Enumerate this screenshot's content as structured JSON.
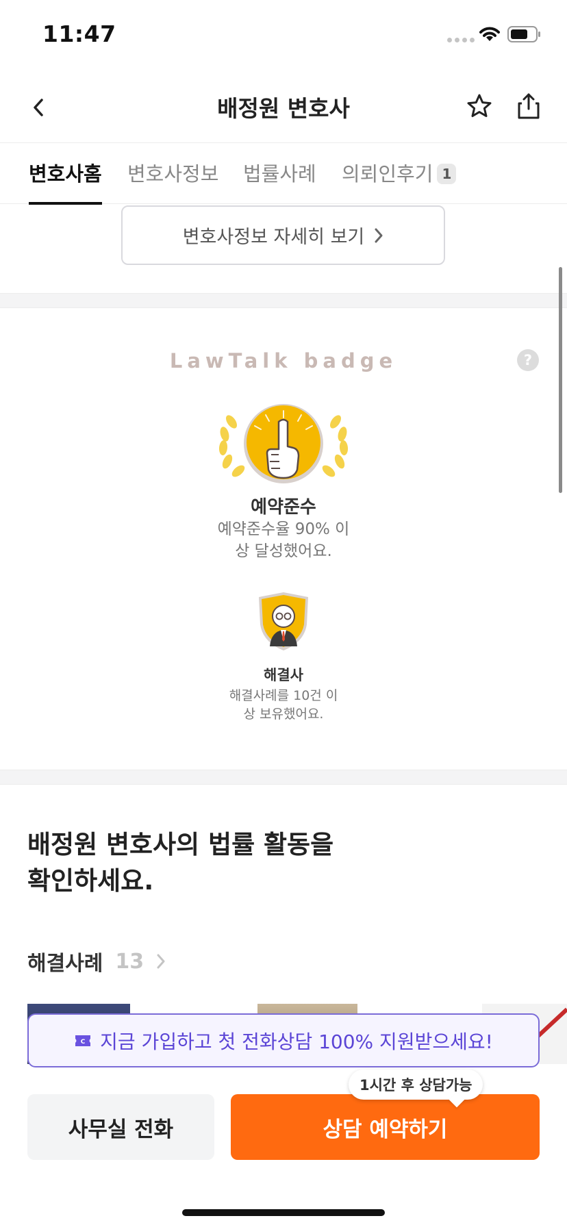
{
  "status_bar": {
    "time": "11:47"
  },
  "header": {
    "title": "배정원 변호사"
  },
  "tabs": [
    {
      "label": "변호사홈"
    },
    {
      "label": "변호사정보"
    },
    {
      "label": "법률사례"
    },
    {
      "label": "의뢰인후기",
      "badge": "1"
    }
  ],
  "detail_button": {
    "label": "변호사정보 자세히 보기"
  },
  "badges_section": {
    "heading": "LawTalk badge",
    "help_icon": "?",
    "badges": [
      {
        "name": "예약준수",
        "desc_line1": "예약준수율 90% 이",
        "desc_line2": "상 달성했어요.",
        "icon": "finger-medal-icon"
      },
      {
        "name": "해결사",
        "desc_line1": "해결사례를 10건 이",
        "desc_line2": "상 보유했어요.",
        "icon": "lawyer-shield-icon"
      }
    ]
  },
  "activity": {
    "title_line1": "배정원 변호사의 법률 활동을",
    "title_line2": "확인하세요.",
    "cases_label": "해결사례",
    "cases_count": "13"
  },
  "promo": {
    "text": "지금 가입하고 첫 전화상담 100% 지원받으세요!"
  },
  "bottom_bar": {
    "office_call": "사무실 전화",
    "reserve": "상담 예약하기",
    "tooltip": "1시간 후 상담가능"
  },
  "colors": {
    "accent": "#ff6a10",
    "promo": "#5b45d6",
    "badge_gold": "#f5b800"
  }
}
